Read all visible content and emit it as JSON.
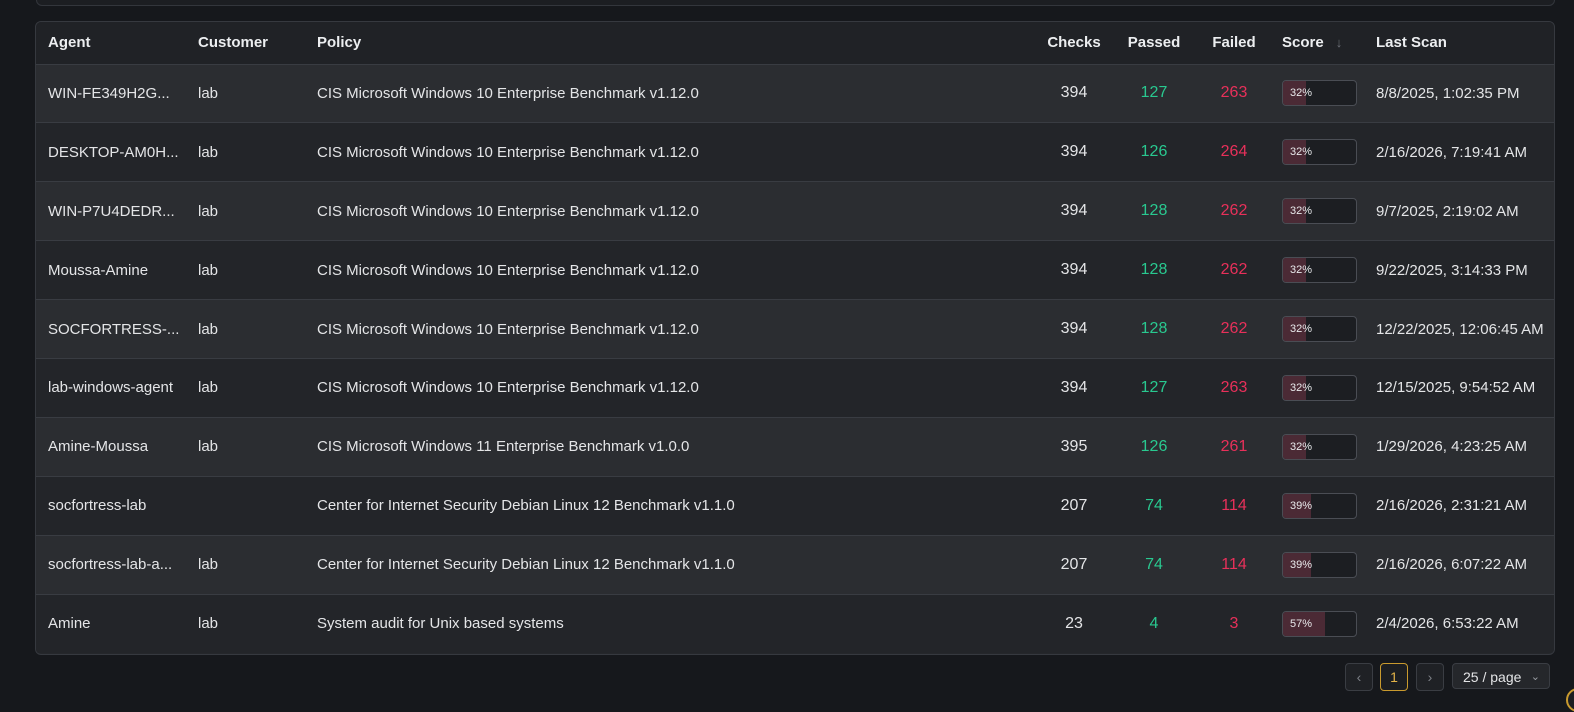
{
  "table": {
    "columns": {
      "agent": "Agent",
      "customer": "Customer",
      "policy": "Policy",
      "checks": "Checks",
      "passed": "Passed",
      "failed": "Failed",
      "score": "Score",
      "last_scan": "Last Scan"
    },
    "sort_icon": "arrow-down-icon",
    "rows": [
      {
        "agent": "WIN-FE349H2G...",
        "customer": "lab",
        "policy": "CIS Microsoft Windows 10 Enterprise Benchmark v1.12.0",
        "checks": "394",
        "passed": "127",
        "failed": "263",
        "score": "32%",
        "score_value": 0.32,
        "last_scan": "8/8/2025, 1:02:35 PM"
      },
      {
        "agent": "DESKTOP-AM0H...",
        "customer": "lab",
        "policy": "CIS Microsoft Windows 10 Enterprise Benchmark v1.12.0",
        "checks": "394",
        "passed": "126",
        "failed": "264",
        "score": "32%",
        "score_value": 0.32,
        "last_scan": "2/16/2026, 7:19:41 AM"
      },
      {
        "agent": "WIN-P7U4DEDR...",
        "customer": "lab",
        "policy": "CIS Microsoft Windows 10 Enterprise Benchmark v1.12.0",
        "checks": "394",
        "passed": "128",
        "failed": "262",
        "score": "32%",
        "score_value": 0.32,
        "last_scan": "9/7/2025, 2:19:02 AM"
      },
      {
        "agent": "Moussa-Amine",
        "customer": "lab",
        "policy": "CIS Microsoft Windows 10 Enterprise Benchmark v1.12.0",
        "checks": "394",
        "passed": "128",
        "failed": "262",
        "score": "32%",
        "score_value": 0.32,
        "last_scan": "9/22/2025, 3:14:33 PM"
      },
      {
        "agent": "SOCFORTRESS-...",
        "customer": "lab",
        "policy": "CIS Microsoft Windows 10 Enterprise Benchmark v1.12.0",
        "checks": "394",
        "passed": "128",
        "failed": "262",
        "score": "32%",
        "score_value": 0.32,
        "last_scan": "12/22/2025, 12:06:45 AM"
      },
      {
        "agent": "lab-windows-agent",
        "customer": "lab",
        "policy": "CIS Microsoft Windows 10 Enterprise Benchmark v1.12.0",
        "checks": "394",
        "passed": "127",
        "failed": "263",
        "score": "32%",
        "score_value": 0.32,
        "last_scan": "12/15/2025, 9:54:52 AM"
      },
      {
        "agent": "Amine-Moussa",
        "customer": "lab",
        "policy": "CIS Microsoft Windows 11 Enterprise Benchmark v1.0.0",
        "checks": "395",
        "passed": "126",
        "failed": "261",
        "score": "32%",
        "score_value": 0.32,
        "last_scan": "1/29/2026, 4:23:25 AM"
      },
      {
        "agent": "socfortress-lab",
        "customer": "",
        "policy": "Center for Internet Security Debian Linux 12 Benchmark v1.1.0",
        "checks": "207",
        "passed": "74",
        "failed": "114",
        "score": "39%",
        "score_value": 0.39,
        "last_scan": "2/16/2026, 2:31:21 AM"
      },
      {
        "agent": "socfortress-lab-a...",
        "customer": "lab",
        "policy": "Center for Internet Security Debian Linux 12 Benchmark v1.1.0",
        "checks": "207",
        "passed": "74",
        "failed": "114",
        "score": "39%",
        "score_value": 0.39,
        "last_scan": "2/16/2026, 6:07:22 AM"
      },
      {
        "agent": "Amine",
        "customer": "lab",
        "policy": "System audit for Unix based systems",
        "checks": "23",
        "passed": "4",
        "failed": "3",
        "score": "57%",
        "score_value": 0.57,
        "last_scan": "2/4/2026, 6:53:22 AM"
      }
    ]
  },
  "pagination": {
    "prev_icon": "chevron-left-icon",
    "next_icon": "chevron-right-icon",
    "current_page": "1",
    "page_size": "25 / page",
    "page_size_icon": "chevron-down-icon"
  },
  "colors": {
    "passed": "#29c990",
    "failed": "#e8305a",
    "accent": "#e3b348",
    "score_fill": "#4b2a35"
  }
}
